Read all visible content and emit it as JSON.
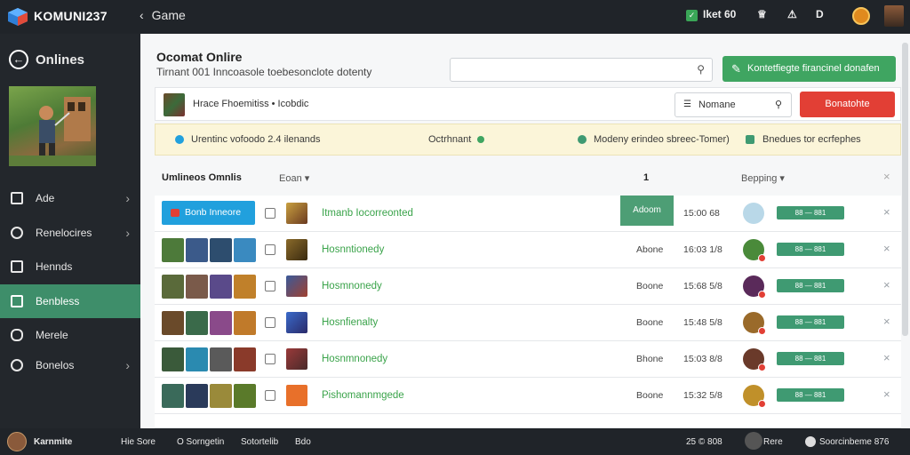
{
  "app": {
    "brand": "KOMUNI237",
    "back_label": "Game"
  },
  "topbar": {
    "count_label": "Iket 60",
    "icon1": "℧",
    "icon2": "℧",
    "d_label": "D"
  },
  "sidebar": {
    "title": "Onlines",
    "items": [
      {
        "label": "Ade",
        "icon": "grid-icon",
        "arrow": true
      },
      {
        "label": "Renelocires",
        "icon": "wrench-icon",
        "arrow": true
      },
      {
        "label": "Hennds",
        "icon": "monitor-icon",
        "arrow": false
      },
      {
        "label": "Benbless",
        "icon": "bag-icon",
        "arrow": false,
        "active": true
      },
      {
        "label": "Merele",
        "icon": "controller-icon",
        "arrow": false
      },
      {
        "label": "Bonelos",
        "icon": "settings-icon",
        "arrow": true
      }
    ]
  },
  "main": {
    "title": "Ocomat Onlire",
    "subtitle": "Tirnant 001 Inncoasole toebesonclote dotenty",
    "search_placeholder": "",
    "green_button": "Kontetfiegte firancinel donafen",
    "card_title": "Hrace Fhoemitiss • Icobdic",
    "sort_label": "Nomane",
    "red_button": "Bonatohte",
    "info": {
      "left": "Urentinc vofoodo 2.4 ilenands",
      "mid": "Octrhnant",
      "right1": "Modeny erindeo sbreec-Tomer)",
      "right2": "Bnedues tor ecrfephes"
    },
    "table_head": {
      "col1": "Umlineos Omnlis",
      "col2": "Eoan ▾",
      "col3": "1",
      "col4": "Bepping ▾"
    }
  },
  "rows": [
    {
      "first_button": "Bonb Inneore",
      "name": "Itmanb Iocorreonted",
      "status": "Adoom",
      "time": "15:00 68",
      "pill": "88 — 881"
    },
    {
      "name": "Hosnntionedy",
      "status": "Abone",
      "time": "16:03 1/8",
      "pill": "88 — 881"
    },
    {
      "name": "Hosmnonedy",
      "status": "Boone",
      "time": "15:68 5/8",
      "pill": "88 — 881"
    },
    {
      "name": "Hosnfienalty",
      "status": "Boone",
      "time": "15:48 5/8",
      "pill": "88 — 881"
    },
    {
      "name": "Hosnmnonedy",
      "status": "Bhone",
      "time": "15:03 8/8",
      "pill": "88 — 881"
    },
    {
      "name": "Pishomannmgede",
      "status": "Boone",
      "time": "15:32 5/8",
      "pill": "88 — 881"
    }
  ],
  "bottombar": {
    "user": "Karnmite",
    "items": [
      "Hie  Sore",
      "O Sorngetin",
      "Sotortelib",
      "Bdo"
    ],
    "right": [
      "25 © 808",
      "Rere",
      "Soorcinbeme 876"
    ]
  },
  "colors": {
    "accent_green": "#3fa561",
    "danger": "#e23f35",
    "info_blue": "#21a0dd",
    "sidebar": "#23272c"
  }
}
